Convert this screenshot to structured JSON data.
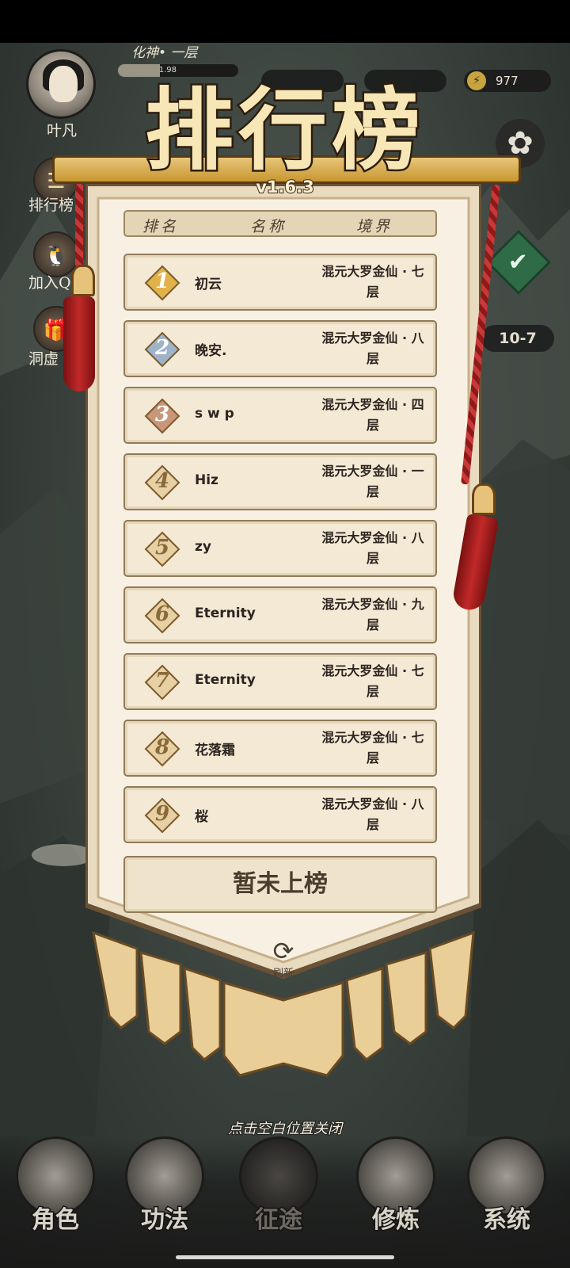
{
  "hud": {
    "player_name": "叶凡",
    "realm": "化神• 一层",
    "exp_text": "1.98",
    "exp_fraction": 0.35,
    "energy": "977"
  },
  "side_menu": [
    {
      "label": "排行榜",
      "icon": "ranking-icon"
    },
    {
      "label": "加入Q",
      "icon": "penguin-icon"
    },
    {
      "label": "洞虚",
      "icon": "gift-icon"
    }
  ],
  "stage": "10-7",
  "leaderboard": {
    "title": "排行榜",
    "version": "v1.6.3",
    "columns": [
      "排名",
      "名称",
      "境界"
    ],
    "entries": [
      {
        "rank": "1",
        "name": "初云",
        "realm_line1": "混元大罗金仙 · 七",
        "realm_line2": "层",
        "medal": "gold"
      },
      {
        "rank": "2",
        "name": "晚安.",
        "realm_line1": "混元大罗金仙 · 八",
        "realm_line2": "层",
        "medal": "silver"
      },
      {
        "rank": "3",
        "name": "s w p",
        "realm_line1": "混元大罗金仙 · 四",
        "realm_line2": "层",
        "medal": "bronze"
      },
      {
        "rank": "4",
        "name": "Hiz",
        "realm_line1": "混元大罗金仙 · 一",
        "realm_line2": "层",
        "medal": "plain"
      },
      {
        "rank": "5",
        "name": "zy",
        "realm_line1": "混元大罗金仙 · 八",
        "realm_line2": "层",
        "medal": "plain"
      },
      {
        "rank": "6",
        "name": "Eternity",
        "realm_line1": "混元大罗金仙 · 九",
        "realm_line2": "层",
        "medal": "plain"
      },
      {
        "rank": "7",
        "name": "Eternity",
        "realm_line1": "混元大罗金仙 · 七",
        "realm_line2": "层",
        "medal": "plain"
      },
      {
        "rank": "8",
        "name": "花落霜",
        "realm_line1": "混元大罗金仙 · 七",
        "realm_line2": "层",
        "medal": "plain"
      },
      {
        "rank": "9",
        "name": "桜",
        "realm_line1": "混元大罗金仙 · 八",
        "realm_line2": "层",
        "medal": "plain"
      }
    ],
    "my_rank_text": "暂未上榜",
    "refresh_label": "刷新"
  },
  "close_hint": "点击空白位置关闭",
  "bottom_nav": [
    {
      "label": "角色",
      "active": false
    },
    {
      "label": "功法",
      "active": false
    },
    {
      "label": "征途",
      "active": true
    },
    {
      "label": "修炼",
      "active": false
    },
    {
      "label": "系统",
      "active": false
    }
  ],
  "colors": {
    "parchment": "#f4e9d4",
    "banner_gold": "#e7c67a",
    "tassel_red": "#b22a2a",
    "medal_gold": "#e1b24a",
    "medal_silver": "#9fb3c8",
    "medal_bronze": "#c9967a",
    "medal_plain": "#e6d0a4"
  }
}
